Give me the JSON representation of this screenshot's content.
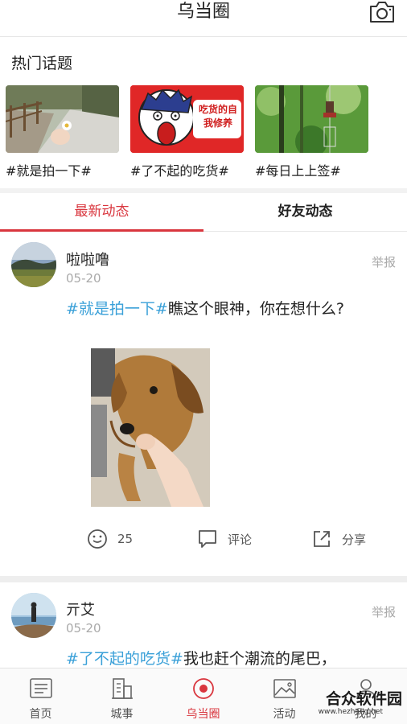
{
  "header": {
    "title": "乌当圈",
    "camera_icon": "camera-icon"
  },
  "hot_topics": {
    "title": "热门话题",
    "items": [
      {
        "label": "#就是拍一下#"
      },
      {
        "label": "#了不起的吃货#",
        "image_text": "吃货的自我修养"
      },
      {
        "label": "#每日上上签#"
      }
    ]
  },
  "tabs": [
    {
      "label": "最新动态",
      "active": true
    },
    {
      "label": "好友动态",
      "active": false
    }
  ],
  "posts": [
    {
      "user": "啦啦噜",
      "date": "05-20",
      "report": "举报",
      "hashtag": "#就是拍一下#",
      "text": "瞧这个眼神，你在想什么?",
      "likes": "25",
      "comment": "评论",
      "share": "分享"
    },
    {
      "user": "亓艾",
      "date": "05-20",
      "report": "举报",
      "hashtag": "#了不起的吃货#",
      "text": "我也赶个潮流的尾巴，"
    }
  ],
  "tabbar": [
    {
      "label": "首页",
      "icon": "document-icon"
    },
    {
      "label": "城事",
      "icon": "building-icon"
    },
    {
      "label": "乌当圈",
      "icon": "circle-icon",
      "active": true
    },
    {
      "label": "活动",
      "icon": "image-icon"
    },
    {
      "label": "我的",
      "icon": "user-icon"
    }
  ],
  "watermark": {
    "text": "合众软件园",
    "url": "www.hezhong.net"
  },
  "colors": {
    "accent": "#d9363e",
    "hashtag": "#3aa0d8",
    "muted": "#aaaaaa"
  }
}
